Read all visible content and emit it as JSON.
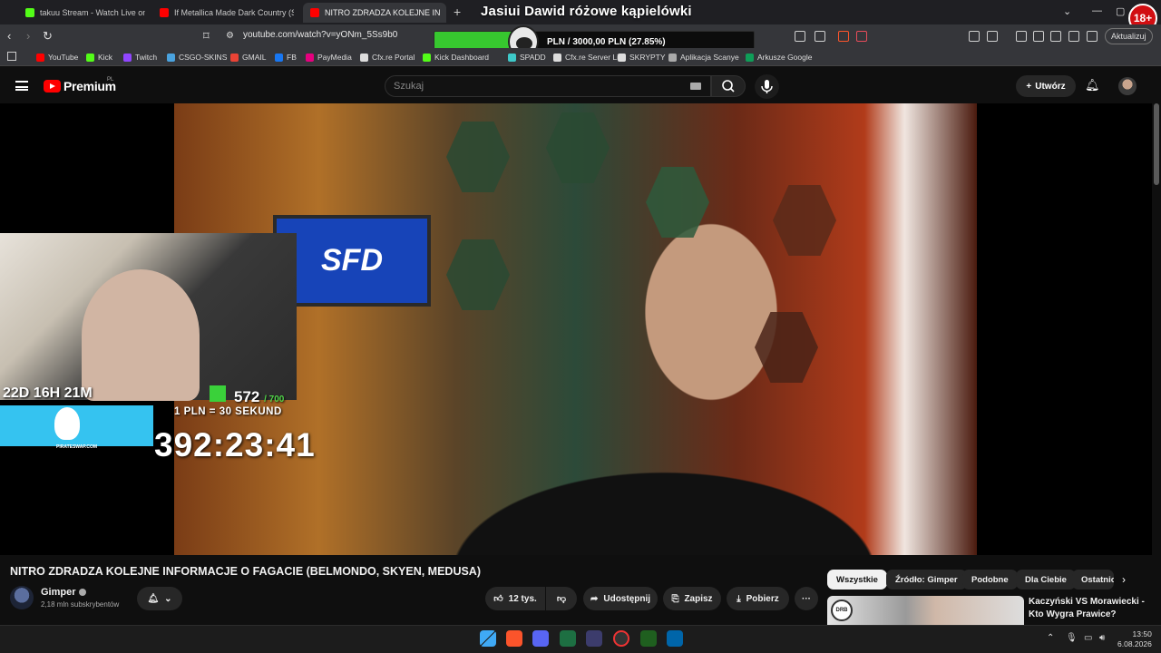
{
  "browser": {
    "tabs": [
      {
        "label": "takuu Stream - Watch Live on Kick",
        "active": false,
        "favicon_color": "#53fc18"
      },
      {
        "label": "If Metallica Made Dark Country (Seek",
        "active": false,
        "favicon_color": "#ff0000"
      },
      {
        "label": "NITRO ZDRADZA KOLEJNE IN",
        "active": true,
        "favicon_color": "#ff0000"
      }
    ],
    "new_tab": "+",
    "overlay_title": "Jasiui Dawid różowe kąpielówki",
    "age_badge": "18+",
    "url": "youtube.com/watch?v=yONm_5Ss9b0",
    "update_label": "Aktualizuj",
    "donation": {
      "text": "PLN / 3000,00 PLN  (27.85%)",
      "progress_fraction": 0.2785,
      "fill_color": "#37c82f"
    },
    "bookmarks": [
      {
        "label": "YouTube",
        "color": "#ff0000"
      },
      {
        "label": "Kick",
        "color": "#53fc18"
      },
      {
        "label": "Twitch",
        "color": "#9146ff"
      },
      {
        "label": "CSGO-SKINS",
        "color": "#4aa3df"
      },
      {
        "label": "GMAIL",
        "color": "#ea4335"
      },
      {
        "label": "FB",
        "color": "#1877f2"
      },
      {
        "label": "PayMedia",
        "color": "#e6007e"
      },
      {
        "label": "Cfx.re Portal",
        "color": "#dddddd"
      },
      {
        "label": "Kick Dashboard",
        "color": "#53fc18"
      },
      {
        "label": "SPADD",
        "color": "#3ec9c9"
      },
      {
        "label": "Cfx.re Server List",
        "color": "#dddddd"
      },
      {
        "label": "SKRYPTY",
        "color": "#dddddd"
      },
      {
        "label": "Aplikacja Scanye",
        "color": "#aaaaaa"
      },
      {
        "label": "Arkusze Google",
        "color": "#0f9d58"
      }
    ]
  },
  "youtube": {
    "brand": "Premium",
    "region": "PL",
    "search_placeholder": "Szukaj",
    "create_label": "Utwórz"
  },
  "stream_overlay": {
    "sign": "SFD",
    "time_left": "22D 16H 21M",
    "counter": "572",
    "counter_max": "/ 700",
    "rate": "1 PLN = 30 SEKUND",
    "big_timer": "392:23:41",
    "sponsor": "PIRATESWAP.COM"
  },
  "video": {
    "title": "NITRO ZDRADZA KOLEJNE INFORMACJE O FAGACIE (BELMONDO, SKYEN, MEDUSA)",
    "channel": "Gimper",
    "subscribers": "2,18 mln subskrybentów",
    "likes": "12 tys.",
    "share": "Udostępnij",
    "save": "Zapisz",
    "download": "Pobierz",
    "more": "···"
  },
  "chips": [
    {
      "label": "Wszystkie",
      "active": true
    },
    {
      "label": "Źródło: Gimper",
      "active": false
    },
    {
      "label": "Podobne",
      "active": false
    },
    {
      "label": "Dla Ciebie",
      "active": false
    },
    {
      "label": "Ostatnio",
      "active": false
    }
  ],
  "recommendation": {
    "title": "Kaczyński VS Morawiecki - Kto Wygra Prawice?",
    "badge": "DRB"
  },
  "taskbar": {
    "time": "13:50",
    "date": "6.08.2026",
    "tray_up": "⌃"
  }
}
